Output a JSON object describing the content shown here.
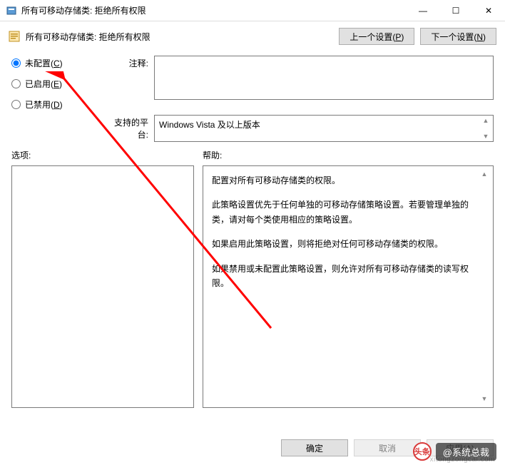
{
  "window": {
    "title": "所有可移动存储类: 拒绝所有权限",
    "minimize": "—",
    "maximize": "☐",
    "close": "✕"
  },
  "toolbar": {
    "title": "所有可移动存储类: 拒绝所有权限",
    "prev_btn": "上一个设置(P)",
    "next_btn": "下一个设置(N)"
  },
  "radio": {
    "not_configured": "未配置(C)",
    "enabled": "已启用(E)",
    "disabled": "已禁用(D)",
    "selected": "not_configured"
  },
  "labels": {
    "comment": "注释:",
    "platform": "支持的平台:",
    "options": "选项:",
    "help": "帮助:"
  },
  "fields": {
    "comment_value": "",
    "platform_value": "Windows Vista 及以上版本"
  },
  "help": {
    "p1": "配置对所有可移动存储类的权限。",
    "p2": "此策略设置优先于任何单独的可移动存储策略设置。若要管理单独的类，请对每个类使用相应的策略设置。",
    "p3": "如果启用此策略设置，则将拒绝对任何可移动存储类的权限。",
    "p4": "如果禁用或未配置此策略设置，则允许对所有可移动存储类的读写权限。"
  },
  "buttons": {
    "ok": "确定",
    "cancel": "取消",
    "apply": "应用(A)"
  },
  "watermark": {
    "badge": "头条",
    "text": "@系统总裁",
    "url": "xitongzongcai.com"
  }
}
